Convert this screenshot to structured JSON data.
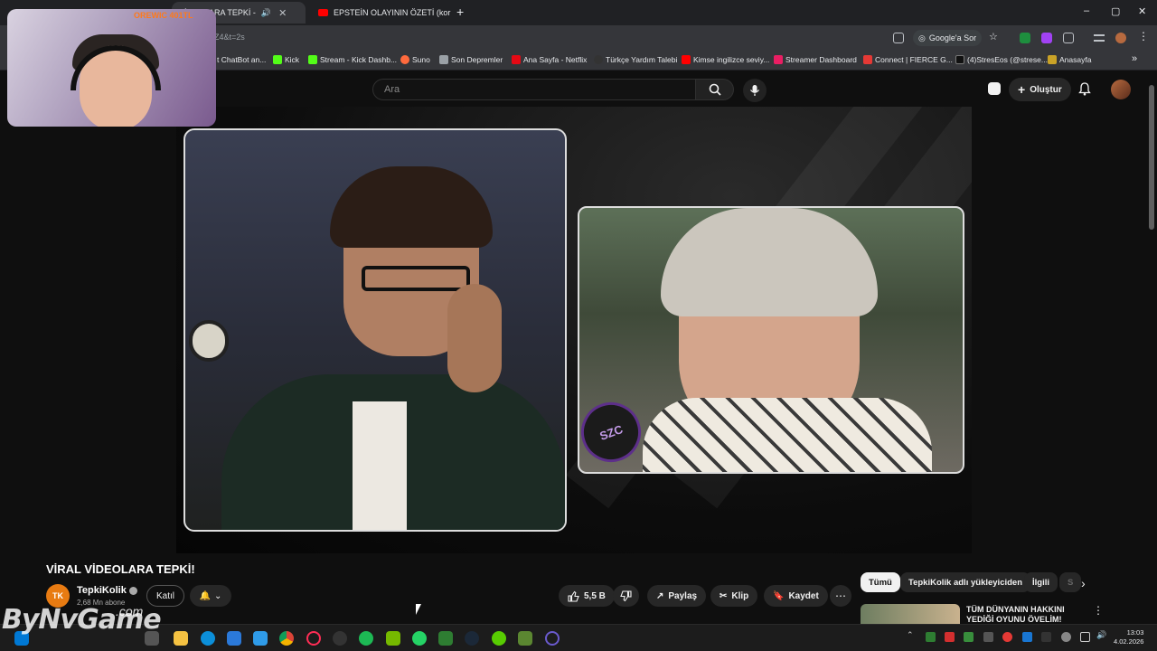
{
  "browser": {
    "tabs": [
      {
        "title": "VİDEOLARA TEPKİ -",
        "active": true
      },
      {
        "title": "EPSTEİN OLAYININ ÖZETİ (kor",
        "active": false
      }
    ],
    "new_tab": "+",
    "window_controls": [
      "–",
      "▢",
      "✕"
    ],
    "url": "Z4&t=2s",
    "google_btn": "Google'a Sor"
  },
  "bookmarks": [
    {
      "label": "t ChatBot an...",
      "color": "#7b68ee"
    },
    {
      "label": "Kick",
      "color": "#53fc18"
    },
    {
      "label": "Stream - Kick Dashb...",
      "color": "#53fc18"
    },
    {
      "label": "Suno",
      "color": "#ff6a3d"
    },
    {
      "label": "Son Depremler",
      "color": "#9aa0a6"
    },
    {
      "label": "Ana Sayfa - Netflix",
      "color": "#e50914"
    },
    {
      "label": "Türkçe Yardım Talebi",
      "color": "#333333"
    },
    {
      "label": "Kimse ingilizce seviy...",
      "color": "#ff0000"
    },
    {
      "label": "Streamer Dashboard",
      "color": "#e91e63"
    },
    {
      "label": "Connect | FIERCE G...",
      "color": "#e53935"
    },
    {
      "label": "(4)StresEos (@strese...",
      "color": "#111111"
    },
    {
      "label": "Anasayfa",
      "color": "#c9a227"
    }
  ],
  "youtube": {
    "search_placeholder": "Ara",
    "create_label": "Oluştur"
  },
  "video": {
    "title": "VİRAL VİDEOLARA TEPKİ!",
    "channel": "TepkiKolik",
    "channel_logo": "TK",
    "subscribers": "2,68 Mn abone",
    "join_label": "Katıl",
    "likes": "5,5 B",
    "share_label": "Paylaş",
    "clip_label": "Klip",
    "save_label": "Kaydet",
    "mic_logo": "SZC"
  },
  "sidebar": {
    "chips": [
      "Tümü",
      "TepkiKolik adlı yükleyiciden",
      "İlgili",
      "S"
    ],
    "recommendation_title": "TÜM DÜNYANIN HAKKINI YEDİĞİ OYUNU ÖVELİM! TÜRK"
  },
  "overlay": {
    "donation_text": "OREWIC 401TL",
    "watermark": "ByNvGame",
    "watermark_suffix": ".com"
  },
  "taskbar": {
    "time": "13:03",
    "date": "4.02.2026"
  }
}
